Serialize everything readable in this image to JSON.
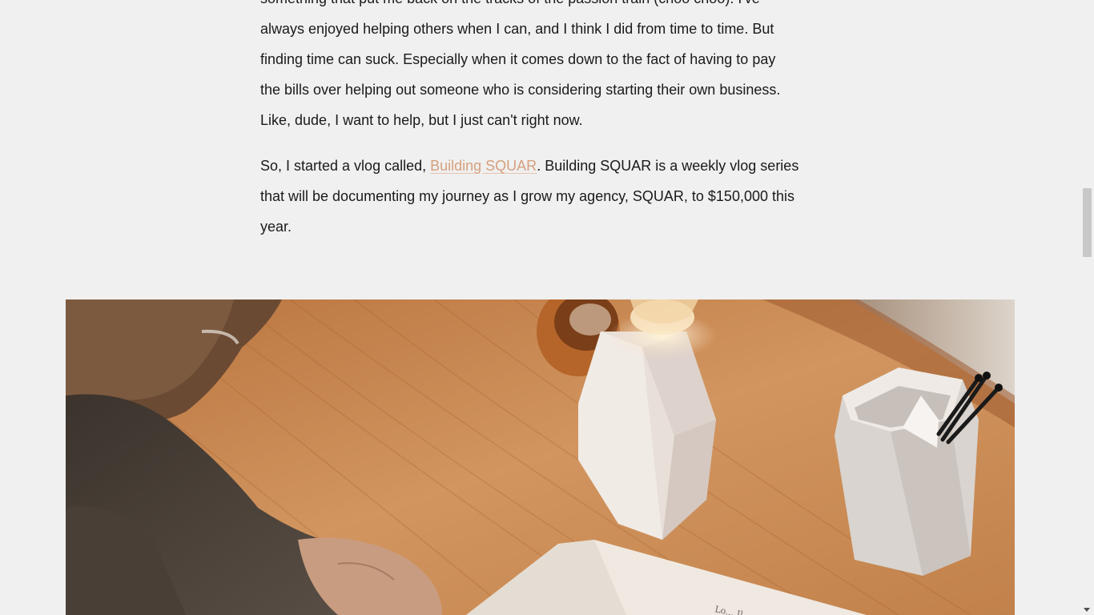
{
  "article": {
    "paragraph_1": {
      "line_1": "something that put me back on the tracks of the passion train (choo choo). I've",
      "line_2": "always enjoyed helping others when I can, and I think I did from time to time. But",
      "line_3": "finding time can suck. Especially when it comes down to the fact of having to pay",
      "line_4": "the bills over helping out someone who is considering starting their own business.",
      "line_5": "Like, dude, I want to help, but I just can't right now."
    },
    "paragraph_2": {
      "prefix": "So, I started a vlog called, ",
      "link_text": "Building SQUAR",
      "line_1_suffix": ". Building SQUAR is a weekly vlog series",
      "line_2": "that will be documenting my journey as I grow my agency, SQUAR, to $150,000 this",
      "line_3": "year."
    }
  },
  "hero_image": {
    "icon": "photo-desk-lamp-notebook",
    "notebook_scribble": "Lo... Il..."
  },
  "colors": {
    "background": "#f0f0f0",
    "text": "#1a1a1a",
    "link": "#d7a07e"
  }
}
